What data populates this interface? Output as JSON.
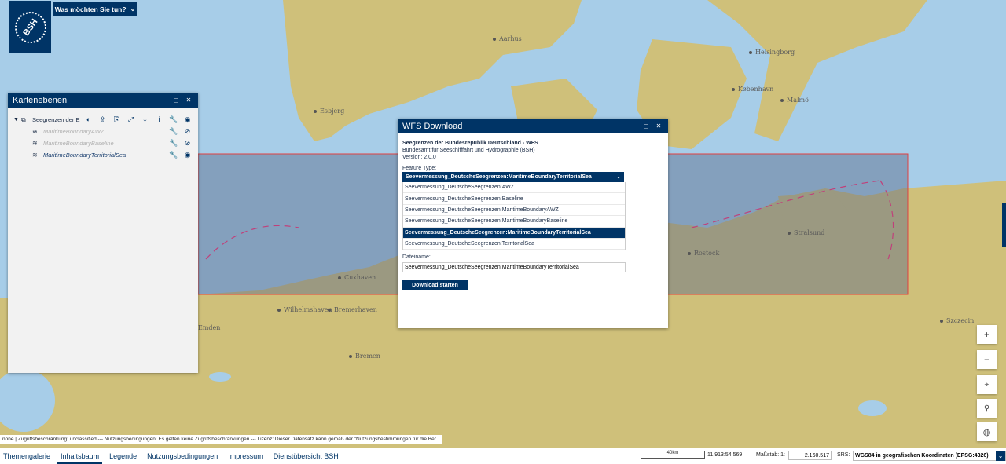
{
  "map": {
    "cities": [
      {
        "name": "Aarhus"
      },
      {
        "name": "Helsingborg"
      },
      {
        "name": "København"
      },
      {
        "name": "Malmö"
      },
      {
        "name": "Esbjerg"
      },
      {
        "name": "Stralsund"
      },
      {
        "name": "Rostock"
      },
      {
        "name": "Cuxhaven"
      },
      {
        "name": "Wilhelmshaven"
      },
      {
        "name": "Bremerhaven"
      },
      {
        "name": "Bremen"
      },
      {
        "name": "Szczecin"
      },
      {
        "name": "Emden"
      }
    ]
  },
  "header": {
    "logo_text": "BSH",
    "what_button": "Was möchten Sie tun?"
  },
  "layers_panel": {
    "title": "Kartenebenen",
    "group_label": "Seegrenzen der E",
    "items": [
      {
        "label": "MaritimeBoundaryAWZ"
      },
      {
        "label": "MaritimeBoundaryBaseline"
      },
      {
        "label": "MaritimeBoundaryTerritorialSea"
      }
    ]
  },
  "wfs_dialog": {
    "title": "WFS Download",
    "service_title": "Seegrenzen der Bundesrepublik Deutschland - WFS",
    "publisher": "Bundesamt für Seeschifffahrt und Hydrographie (BSH)",
    "version": "Version: 2.0.0",
    "feature_type_label": "Feature Type:",
    "selected_feature_type": "Seevermessung_DeutscheSeegrenzen:MaritimeBoundaryTerritorialSea",
    "options": [
      {
        "label": "Seevermessung_DeutscheSeegrenzen:AWZ"
      },
      {
        "label": "Seevermessung_DeutscheSeegrenzen:Baseline"
      },
      {
        "label": "Seevermessung_DeutscheSeegrenzen:MaritimeBoundaryAWZ"
      },
      {
        "label": "Seevermessung_DeutscheSeegrenzen:MaritimeBoundaryBaseline"
      },
      {
        "label": "Seevermessung_DeutscheSeegrenzen:MaritimeBoundaryTerritorialSea"
      },
      {
        "label": "Seevermessung_DeutscheSeegrenzen:TerritorialSea"
      }
    ],
    "filename_label": "Dateiname:",
    "filename_value": "Seevermessung_DeutscheSeegrenzen:MaritimeBoundaryTerritorialSea",
    "download_button": "Download starten"
  },
  "attribution": "none | Zugriffsbeschränkung: unclassified --- Nutzungsbedingungen: Es gelten keine Zugriffsbeschränkungen --- Lizenz: Dieser Datensatz kann gemäß der \"Nutzungsbestimmungen für die Ber...",
  "footer": {
    "tabs": [
      {
        "label": "Themengalerie"
      },
      {
        "label": "Inhaltsbaum"
      },
      {
        "label": "Legende"
      },
      {
        "label": "Nutzungsbedingungen"
      },
      {
        "label": "Impressum"
      },
      {
        "label": "Dienstübersicht BSH"
      }
    ],
    "scale_bar_label": "40km",
    "coordinates": "11,913:54,569",
    "scale_label": "Maßstab: 1:",
    "scale_value": "2.160.517",
    "srs_label": "SRS:",
    "srs_value": "WGS84 in geografischen Koordinaten (EPSG:4326)"
  },
  "colors": {
    "brand": "#003466",
    "land": "#cfc07a",
    "sea": "#a7cde8",
    "selection_box": "#e04040"
  }
}
